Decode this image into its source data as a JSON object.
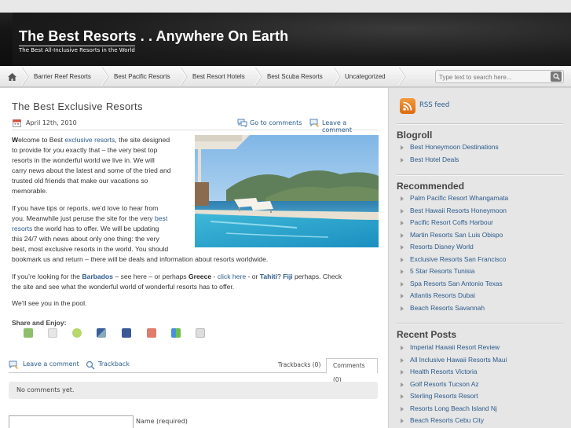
{
  "header": {
    "title": "The Best Resorts . . Anywhere On Earth",
    "tagline": "The Best All-Inclusive Resorts in the World"
  },
  "nav": {
    "home_icon": "home-icon",
    "items": [
      "Barrier Reef Resorts",
      "Best Pacific Resorts",
      "Best Resort Hotels",
      "Best Scuba Resorts",
      "Uncategorized"
    ],
    "search_placeholder": "Type text to search here..."
  },
  "post": {
    "title": "The Best Exclusive Resorts",
    "date": "April 12th, 2010",
    "go_to_comments": "Go to comments",
    "leave_comment": "Leave a comment",
    "p1": {
      "lead": "W",
      "t1": "elcome to Best ",
      "link": "exclusive resorts",
      "t2": ", the site designed",
      "lines": [
        "to provide for you exactly that – the very best top",
        "resorts in the wonderful world we live in.  We will",
        "carry news about the latest and some of the tried and",
        "trusted old friends that make our vacations so",
        "memorable."
      ]
    },
    "p2": {
      "l1": "If you have tips or reports, we’d love to hear from",
      "l2a": "you.  Meanwhile just peruse the site for the very ",
      "l2link": "best",
      "l3link": "resorts",
      "l3b": " the world has to offer.  We will be updating",
      "l4": "this 24/7 with news about only one thing:  the very",
      "l5": "best, most exclusive resorts in the world.  You should",
      "l6": "bookmark us and return – there will be deals and information about resorts worldwide."
    },
    "p3": {
      "a": "If you’re looking for the ",
      "barbados": "Barbados",
      "b": " – see here – or perhaps ",
      "greece": "Greece",
      "c": " - ",
      "click": "click here",
      "d": " - or ",
      "tahiti": "Tahiti",
      "e": "?  ",
      "fiji": "Fiji",
      "f": " perhaps.  Check",
      "l2": "the site and see what the wonderful world of wonderful resorts has to offer."
    },
    "p4": "We’ll see you in the pool.",
    "share_label": "Share and Enjoy:"
  },
  "comments": {
    "leave_comment": "Leave a comment",
    "trackback": "Trackback",
    "tab_trackbacks": "Trackbacks (0)",
    "tab_comments": "Comments (0)",
    "no_comments": "No comments yet.",
    "name_label": "Name (required)"
  },
  "sidebar": {
    "rss": "RSS feed",
    "blogroll_title": "Blogroll",
    "blogroll": [
      "Best Honeymoon Destinations",
      "Best Hotel Deals"
    ],
    "recommended_title": "Recommended",
    "recommended": [
      "Palm Pacific Resort Whangamata",
      "Best Hawaii Resorts Honeymoon",
      "Pacific Resort Coffs Harbour",
      "Martin Resorts San Luis Obispo",
      "Resorts Disney World",
      "Exclusive Resorts San Francisco",
      "5 Star Resorts Tunisia",
      "Spa Resorts San Antonio Texas",
      "Atlantis Resorts Dubai",
      "Beach Resorts Savannah"
    ],
    "recent_title": "Recent Posts",
    "recent": [
      "Imperial Hawaii Resort Review",
      "All Inclusive Hawaii Resorts Maui",
      "Health Resorts Victoria",
      "Golf Resorts Tucson Az",
      "Sterling Resorts Resort",
      "Resorts Long Beach Island Nj",
      "Beach Resorts Cebu City"
    ]
  }
}
